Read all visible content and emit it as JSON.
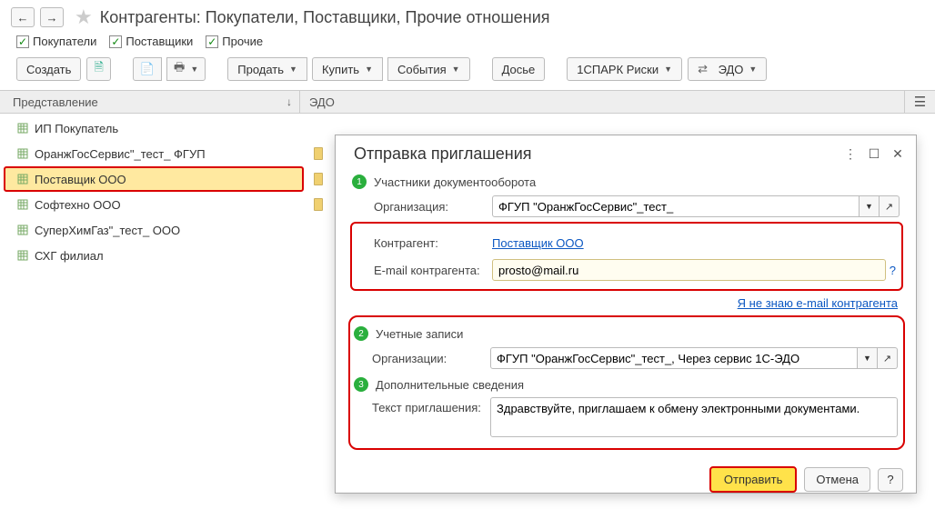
{
  "header": {
    "title": "Контрагенты: Покупатели, Поставщики, Прочие отношения"
  },
  "filters": {
    "buyers": "Покупатели",
    "suppliers": "Поставщики",
    "others": "Прочие"
  },
  "toolbar": {
    "create": "Создать",
    "sell": "Продать",
    "buy": "Купить",
    "events": "События",
    "dossier": "Досье",
    "spark": "1СПАРК Риски",
    "edo": "ЭДО"
  },
  "table": {
    "col1": "Представление",
    "col2": "ЭДО",
    "rows": [
      {
        "name": "ИП Покупатель",
        "edo": false
      },
      {
        "name": "ОранжГосСервис\"_тест_ ФГУП",
        "edo": true
      },
      {
        "name": "Поставщик ООО",
        "edo": true
      },
      {
        "name": "Софтехно ООО",
        "edo": true
      },
      {
        "name": "СуперХимГаз\"_тест_ ООО",
        "edo": false
      },
      {
        "name": "СХГ филиал",
        "edo": false
      }
    ],
    "selected_index": 2
  },
  "modal": {
    "title": "Отправка приглашения",
    "step1": "Участники документооборота",
    "org_label": "Организация:",
    "org_value": "ФГУП \"ОранжГосСервис\"_тест_",
    "counterparty_label": "Контрагент:",
    "counterparty_value": "Поставщик ООО",
    "email_label": "E-mail контрагента:",
    "email_value": "prosto@mail.ru",
    "unknown_email": "Я не знаю e-mail контрагента",
    "step2": "Учетные записи",
    "accounts_label": "Организации:",
    "accounts_value": "ФГУП \"ОранжГосСервис\"_тест_, Через сервис 1С-ЭДО",
    "step3": "Дополнительные сведения",
    "invite_text_label": "Текст приглашения:",
    "invite_text_value": "Здравствуйте, приглашаем к обмену электронными документами.",
    "send": "Отправить",
    "cancel": "Отмена"
  }
}
